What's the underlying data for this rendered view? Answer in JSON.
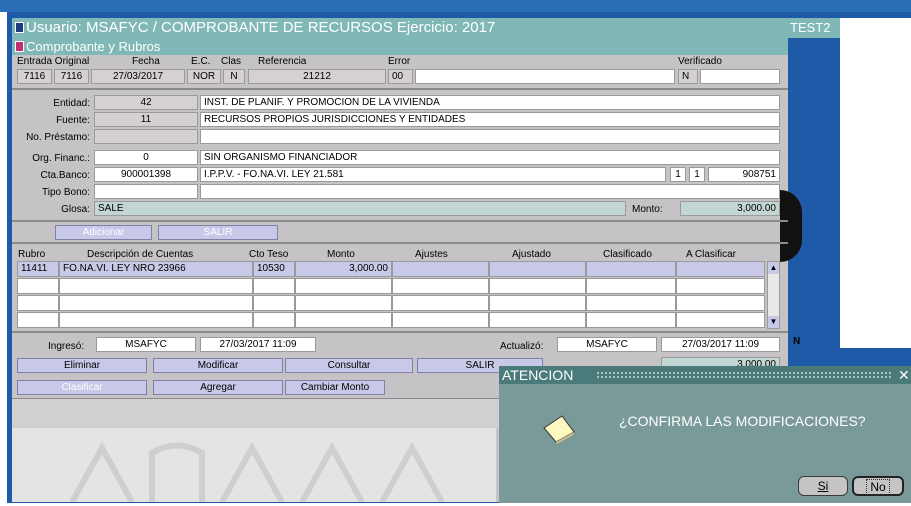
{
  "window": {
    "title": "Usuario: MSAFYC   /   COMPROBANTE DE RECURSOS  Ejercicio: 2017",
    "subtitle": "Comprobante y Rubros",
    "side_tag": "TEST2",
    "side_letter": "N"
  },
  "header_labels": {
    "entrada": "Entrada Original",
    "fecha": "Fecha",
    "ec": "E.C.",
    "clas": "Clas",
    "referencia": "Referencia",
    "error": "Error",
    "verificado": "Verificado"
  },
  "header_values": {
    "entrada_1": "7116",
    "entrada_2": "7116",
    "fecha": "27/03/2017",
    "ec": "NOR",
    "clas": "N",
    "referencia": "21212",
    "error_code": "00",
    "error_text": "",
    "verificado": "N",
    "verificado_extra": ""
  },
  "details": {
    "entidad_label": "Entidad:",
    "entidad_code": "42",
    "entidad_desc": "INST. DE PLANIF. Y PROMOCION DE LA VIVIENDA",
    "fuente_label": "Fuente:",
    "fuente_code": "11",
    "fuente_desc": "RECURSOS PROPIOS JURISDICCIONES Y ENTIDADES",
    "prestamo_label": "No. Préstamo:",
    "prestamo_code": "",
    "prestamo_desc": "",
    "org_label": "Org. Financ.:",
    "org_code": "0",
    "org_desc": "SIN ORGANISMO FINANCIADOR",
    "cta_label": "Cta.Banco:",
    "cta_code": "900001398",
    "cta_desc": "I.P.P.V. - FO.NA.VI. LEY 21.581",
    "cta_extra_1": "1",
    "cta_extra_2": "1",
    "cta_extra_3": "908751",
    "bono_label": "Tipo Bono:",
    "bono_value": "",
    "glosa_label": "Glosa:",
    "glosa_value": "SALE",
    "monto_label": "Monto:",
    "monto_value": "3,000.00"
  },
  "mid_buttons": {
    "adicionar": "Adicionar",
    "salir": "SALIR"
  },
  "table": {
    "headers": [
      "Rubro",
      "Descripción de Cuentas",
      "Cto Teso",
      "Monto",
      "Ajustes",
      "Ajustado",
      "Clasificado",
      "A Clasificar"
    ],
    "rows": [
      [
        "11411",
        "FO.NA.VI. LEY NRO 23966",
        "10530",
        "3,000.00",
        "",
        "",
        "",
        ""
      ],
      [
        "",
        "",
        "",
        "",
        "",
        "",
        "",
        ""
      ],
      [
        "",
        "",
        "",
        "",
        "",
        "",
        "",
        ""
      ],
      [
        "",
        "",
        "",
        "",
        "",
        "",
        "",
        ""
      ]
    ]
  },
  "audit": {
    "ingreso_label": "Ingresó:",
    "ingreso_user": "MSAFYC",
    "ingreso_date": "27/03/2017 11:09",
    "actualizo_label": "Actualizó:",
    "actualizo_user": "MSAFYC",
    "actualizo_date": "27/03/2017 11:09",
    "hidden_value": "3,000.00"
  },
  "actions": {
    "eliminar": "Eliminar",
    "modificar": "Modificar",
    "consultar": "Consultar",
    "salir": "SALIR",
    "clasificar": "Clasificar",
    "agregar": "Agregar",
    "cambiar_monto": "Cambiar Monto"
  },
  "dialog": {
    "title": "ATENCION",
    "message": "¿CONFIRMA LAS MODIFICACIONES?",
    "yes": "Si",
    "no": "No",
    "icon": "note-icon"
  },
  "colors": {
    "title_bar": "#7fb8b6",
    "window_frame": "#1e5aa8",
    "panel": "#c6c3c6",
    "button": "#c8c8e8",
    "dialog_title": "#4a7a7a",
    "dialog_body": "#7a9a9a"
  }
}
